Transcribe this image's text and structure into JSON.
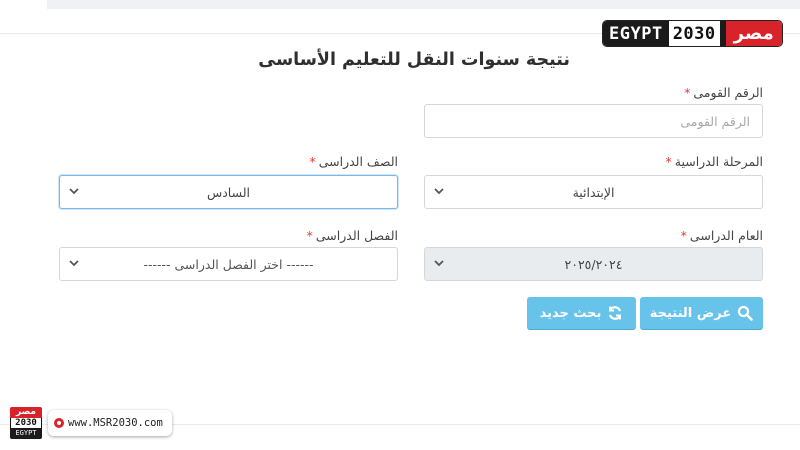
{
  "logo": {
    "english": "EGYPT",
    "year": "2030",
    "arabic": "مصر"
  },
  "page_title": "نتيجة سنوات النقل للتعليم الأساسى",
  "form": {
    "national_id": {
      "label": "الرقم القومى",
      "required_mark": "*",
      "placeholder": "الرقم القومى"
    },
    "stage": {
      "label": "المرحلة الدراسية",
      "required_mark": "*",
      "value": "الإبتدائية"
    },
    "grade": {
      "label": "الصف الدراسى",
      "required_mark": "*",
      "value": "السادس"
    },
    "year": {
      "label": "العام الدراسى",
      "required_mark": "*",
      "value": "٢٠٢٥/٢٠٢٤"
    },
    "term": {
      "label": "الفصل الدراسى",
      "required_mark": "*",
      "value": "------ اختر الفصل الدراسى ------"
    }
  },
  "buttons": {
    "show_result": {
      "label": "عرض النتيجة",
      "icon": "search-icon"
    },
    "new_search": {
      "label": "بحث جديد",
      "icon": "refresh-icon"
    }
  },
  "colors": {
    "button": "#67c3ea",
    "required": "#e03b3b",
    "brand_red": "#d8232a"
  },
  "watermark": {
    "logo_arabic": "مصر",
    "logo_year": "2030",
    "logo_english": "EGYPT",
    "url": "www.MSR2030.com"
  }
}
